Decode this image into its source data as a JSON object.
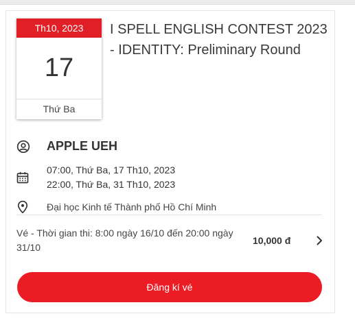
{
  "event": {
    "month_label": "Th10, 2023",
    "day": "17",
    "weekday": "Thứ Ba",
    "title": "I SPELL ENGLISH CONTEST 2023 - IDENTITY: Preliminary Round",
    "organizer": "APPLE UEH",
    "start_datetime": "07:00, Thứ Ba, 17 Th10, 2023",
    "end_datetime": "22:00, Thứ Ba, 31 Th10, 2023",
    "location": "Đại học Kinh tế Thành phố Hồ Chí Minh"
  },
  "ticket": {
    "description": "Vé - Thời gian thi: 8:00 ngày 16/10 đến 20:00 ngày 31/10",
    "price": "10,000 đ"
  },
  "actions": {
    "register_label": "Đăng kí vé"
  },
  "icons": {
    "organizer": "account-circle-icon",
    "datetime": "calendar-icon",
    "location": "map-pin-icon",
    "expand": "chevron-right-icon"
  },
  "colors": {
    "accent": "#ec1c24",
    "month_banner": "#e11f26"
  }
}
